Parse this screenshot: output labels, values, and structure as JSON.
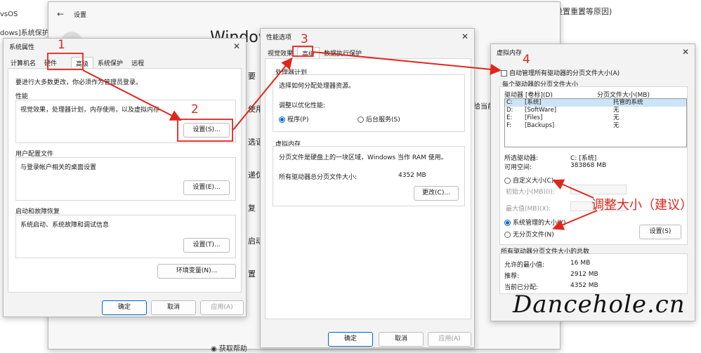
{
  "bg_page": {
    "left_lines": [
      "vsOS",
      "dows]系统保护:"
    ],
    "right_text": "设置重置等原因)",
    "help_link": "获取帮助"
  },
  "settings_window": {
    "title": "设置",
    "heading_partial": "Window",
    "side_items": [
      "要",
      "使用",
      "选语",
      "递伪",
      "复",
      "启动",
      "置"
    ],
    "right_partial": "给当前"
  },
  "sys_props": {
    "title": "系统属性",
    "tabs": [
      "计算机名",
      "硬件",
      "高级",
      "系统保护",
      "远程"
    ],
    "admin_note": "要进行大多数更改，你必须作为管理员登录。",
    "perf": {
      "title": "性能",
      "desc": "视觉效果，处理器计划，内存使用，以及虚拟内存",
      "button": "设置(S)..."
    },
    "profile": {
      "title": "用户配置文件",
      "desc": "与登录帐户相关的桌面设置",
      "button": "设置(E)..."
    },
    "startup": {
      "title": "启动和故障恢复",
      "desc": "系统启动、系统故障和调试信息",
      "button": "设置(T)..."
    },
    "env_button": "环境变量(N)...",
    "ok": "确定",
    "cancel": "取消",
    "apply": "应用(A)"
  },
  "perf_opts": {
    "title": "性能选项",
    "tabs": [
      "视觉效果",
      "高级",
      "数据执行保护"
    ],
    "sched_title": "处理器计划",
    "sched_desc": "选择如何分配处理器资源。",
    "optimize_label": "调整以优化性能:",
    "opt_programs": "程序(P)",
    "opt_services": "后台服务(S)",
    "vm_title": "虚拟内存",
    "vm_desc": "分页文件是硬盘上的一块区域，Windows 当作 RAM 使用。",
    "total_label": "所有驱动器总分页文件大小:",
    "total_value": "4352 MB",
    "change_button": "更改(C)...",
    "ok": "确定",
    "cancel": "取消",
    "apply": "应用(A)"
  },
  "vm_dialog": {
    "title": "虚拟内存",
    "auto_label": "自动管理所有驱动器的分页文件大小(A)",
    "each_drive": "每个驱动器的分页文件大小",
    "col_drive": "驱动器 [卷标](D)",
    "col_size": "分页文件大小(MB)",
    "drives": [
      {
        "drive": "C:",
        "label": "[系统]",
        "size": "托管的系统"
      },
      {
        "drive": "D:",
        "label": "[SoftWare]",
        "size": "无"
      },
      {
        "drive": "E:",
        "label": "[Files]",
        "size": "无"
      },
      {
        "drive": "F:",
        "label": "[Backups]",
        "size": "无"
      }
    ],
    "sel_drive_label": "所选驱动器:",
    "sel_drive_value": "C:  [系统]",
    "free_label": "可用空间:",
    "free_value": "383868 MB",
    "custom_label": "自定义大小(C):",
    "init_label": "初始大小(MB)(I):",
    "max_label": "最大值(MB)(X):",
    "system_managed": "系统管理的大小(Y)",
    "no_paging": "无分页文件(N)",
    "set_button": "设置(S)",
    "total_title": "所有驱动器分页文件大小的总数",
    "min_label": "允许的最小值:",
    "min_value": "16 MB",
    "rec_label": "推荐:",
    "rec_value": "2912 MB",
    "cur_label": "当前已分配:",
    "cur_value": "4352 MB"
  },
  "annotations": {
    "n1": "1",
    "n2": "2",
    "n3": "3",
    "n4": "4",
    "suggest": "调整大小（建议）",
    "watermark": "Dancehole.cn",
    "color": "#e0261b"
  }
}
